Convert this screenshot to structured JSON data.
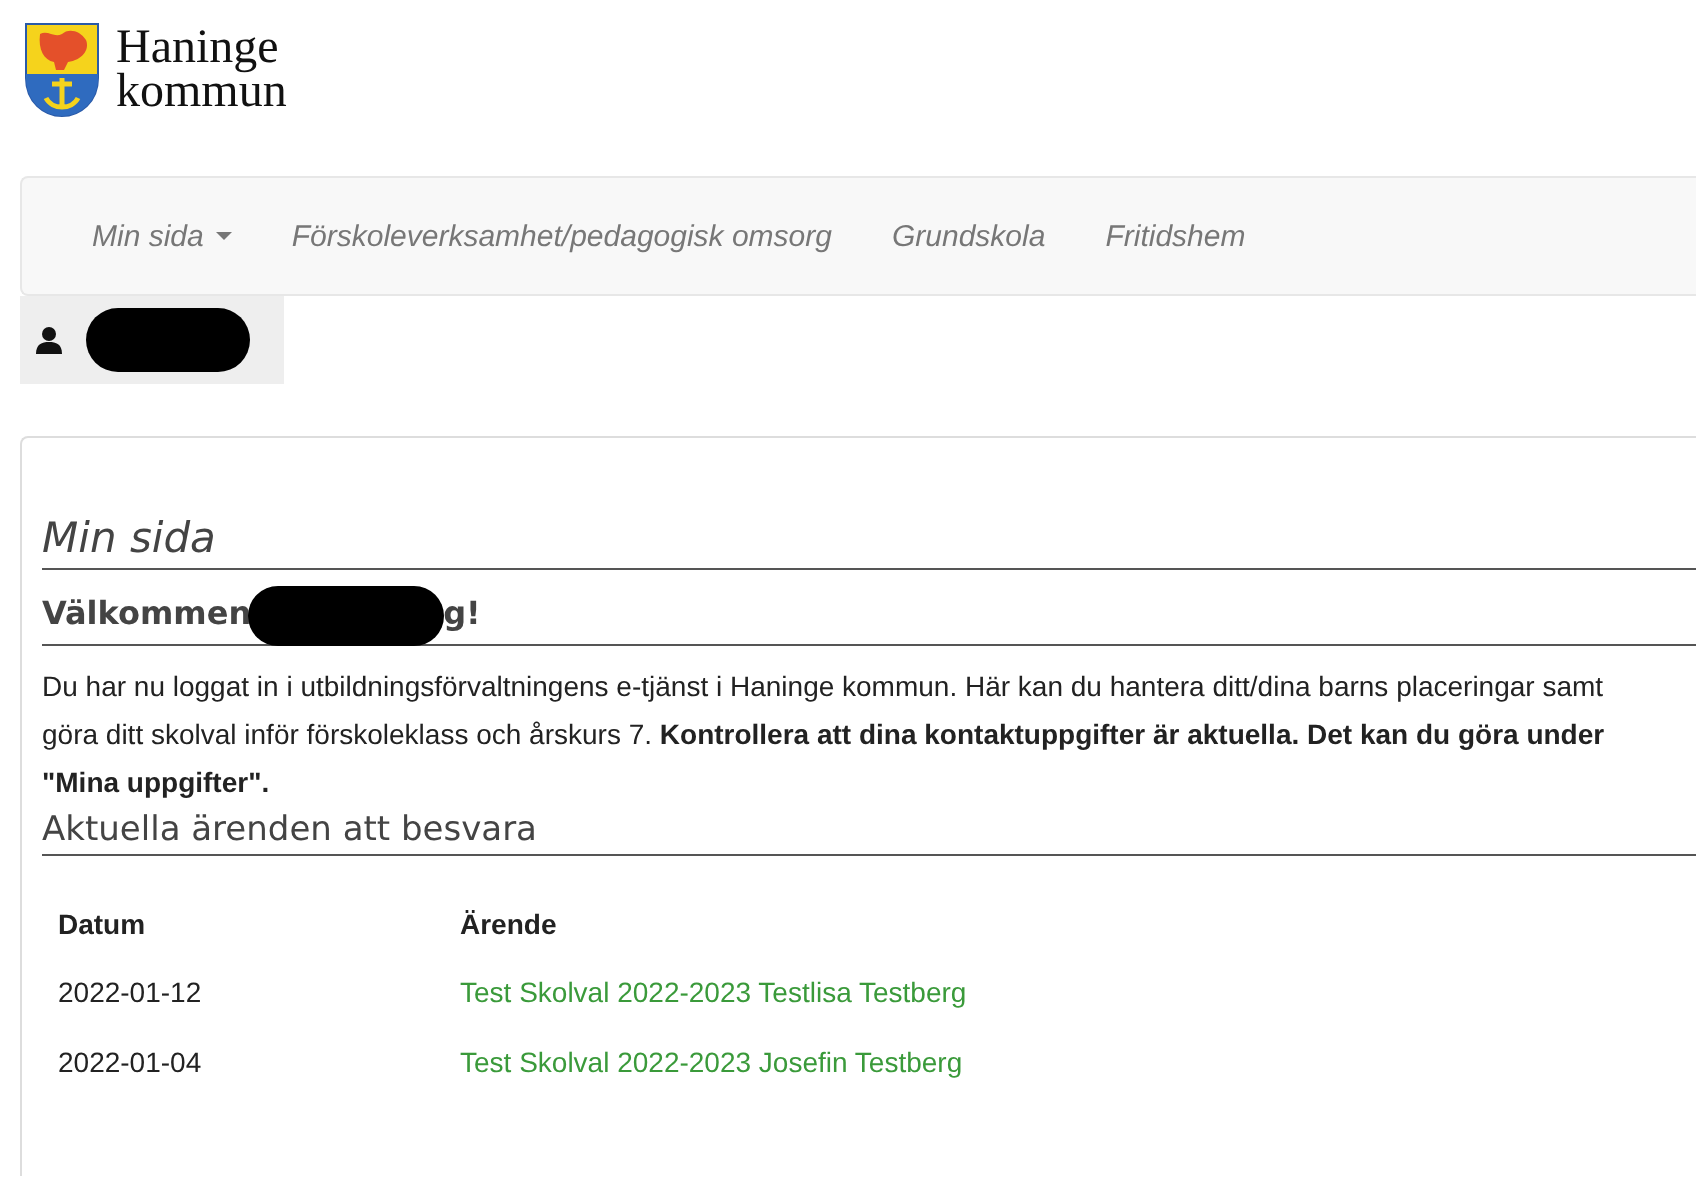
{
  "logo": {
    "line_1": "Haninge",
    "line_2": "kommun"
  },
  "nav": {
    "items": [
      {
        "label": "Min sida",
        "kind": "dropdown"
      },
      {
        "label": "Förskoleverksamhet/pedagogisk omsorg",
        "kind": "link"
      },
      {
        "label": "Grundskola",
        "kind": "link"
      },
      {
        "label": "Fritidshem",
        "kind": "link"
      }
    ]
  },
  "page": {
    "title": "Min sida",
    "welcome_start": "Välkommen",
    "welcome_end": "g!",
    "intro": "Du har nu loggat in i utbildningsförvaltningens e-tjänst i Haninge kommun. Här kan du hantera ditt/dina barns placeringar samt göra ditt skolval inför förskoleklass och årskurs 7. **Kontrollera att dina kontaktuppgifter är aktuella. Det kan du göra under \"Mina uppgifter\".**",
    "cases_heading": "Aktuella ärenden att besvara",
    "table": {
      "columns": [
        "Datum",
        "Ärende"
      ],
      "rows": [
        {
          "date": "2022-01-12",
          "case": "Test Skolval 2022-2023 Testlisa Testberg"
        },
        {
          "date": "2022-01-04",
          "case": "Test Skolval 2022-2023 Josefin Testberg"
        }
      ]
    }
  }
}
